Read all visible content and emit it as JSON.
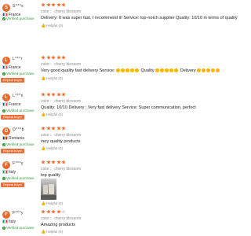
{
  "colors": {
    "star_filled": "#f26a2a",
    "star_empty": "#d9d9d9",
    "verified_green": "#2e9a3c",
    "repeat_badge": "#e8703a",
    "avatar": "#e36a2e"
  },
  "labels": {
    "verified": "Verified purchase",
    "repeat": "Repeat buyer",
    "color_label": "color",
    "sep": ":",
    "helpful": "Helpful (0)"
  },
  "reviews": [
    {
      "initial": "S",
      "username": "S***s",
      "country": "France",
      "rating": 5,
      "color_value": "cherry blossom",
      "text": "Delivery: It was super fast, I recommend it! Service: top-notch supplier Quality: 10/10 in terms of quality",
      "repeat_buyer": false,
      "has_photo": false
    },
    {
      "initial": "L",
      "username": "L***r",
      "country": "France",
      "rating": 5,
      "color_value": "cherry blossom",
      "text_parts": [
        "Very good quality fast delivery Service:",
        "Quality",
        "Delivery"
      ],
      "repeat_buyer": true,
      "has_photo": false
    },
    {
      "initial": "L",
      "username": "L***n",
      "country": "France",
      "rating": 5,
      "color_value": "cherry blossom",
      "text": "Quality: 10/10 Delivery : Very fast delivery Service: Super communication, perfect",
      "repeat_buyer": true,
      "has_photo": false
    },
    {
      "initial": "O",
      "username": "O***b",
      "country": "Romania",
      "rating": 5,
      "color_value": "cherry blossom",
      "text": "very quality products",
      "repeat_buyer": true,
      "has_photo": false
    },
    {
      "initial": "F",
      "username": "F***y",
      "country": "Italy",
      "rating": 5,
      "color_value": "cherry blossom",
      "text": "top quality",
      "repeat_buyer": true,
      "has_photo": true
    },
    {
      "initial": "F",
      "username": "F***y",
      "country": "Italy",
      "rating": 4,
      "color_value": "cherry blossom",
      "text": "Amazing products",
      "repeat_buyer": false,
      "has_photo": false
    }
  ]
}
